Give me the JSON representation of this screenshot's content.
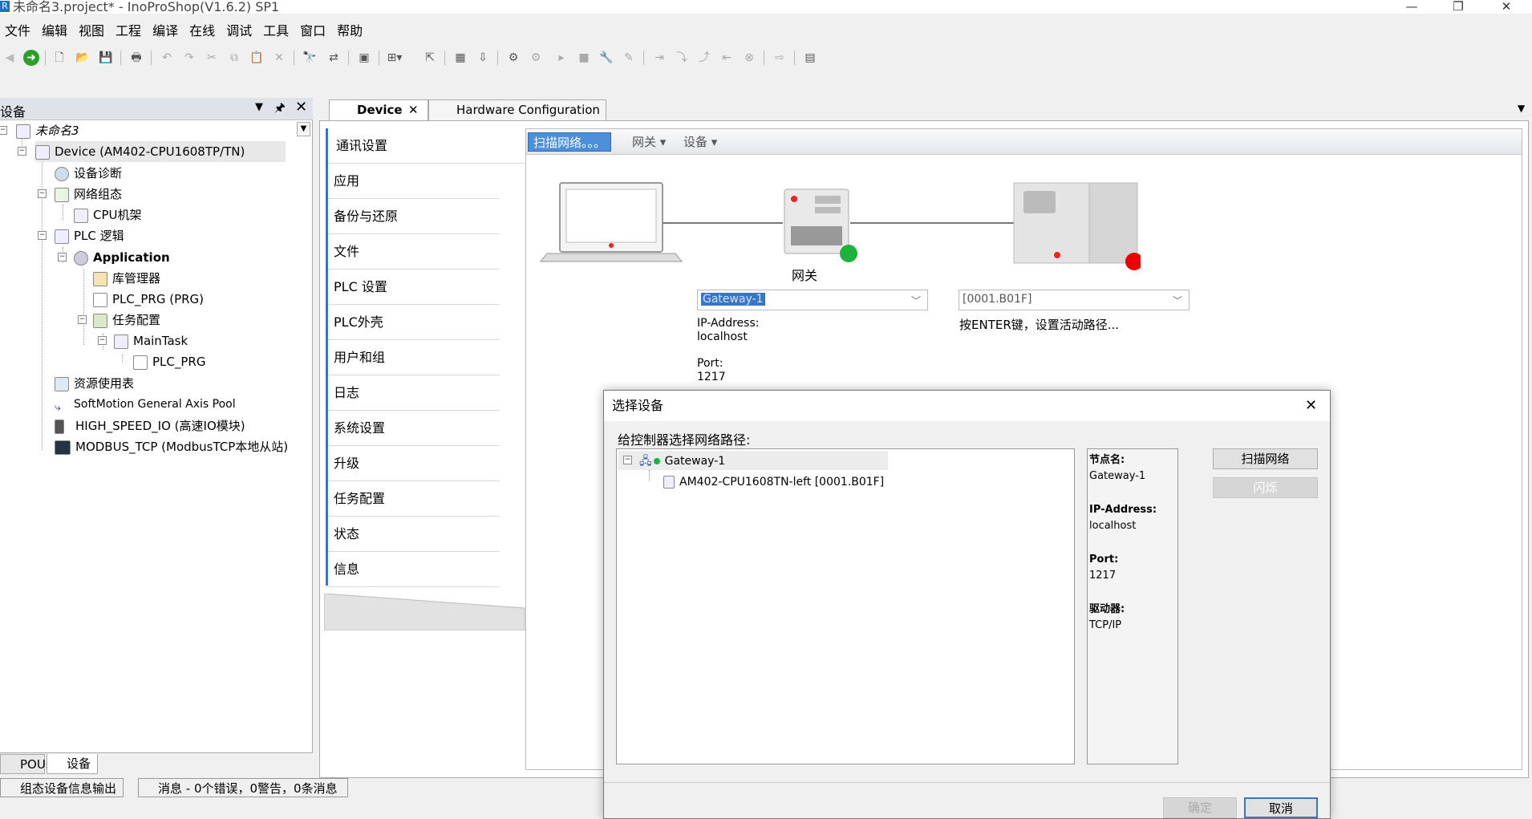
{
  "window": {
    "title": "未命名3.project* - InoProShop(V1.6.2) SP1",
    "app_icon": "R"
  },
  "menubar": [
    "文件",
    "编辑",
    "视图",
    "工程",
    "编译",
    "在线",
    "调试",
    "工具",
    "窗口",
    "帮助"
  ],
  "devices_panel": {
    "title": "设备",
    "tree": [
      {
        "label": "未命名3",
        "icon": "project-icon"
      },
      {
        "label": "Device (AM402-CPU1608TP/TN)",
        "icon": "device-icon"
      },
      {
        "label": "设备诊断",
        "icon": "magnifier-icon"
      },
      {
        "label": "网络组态",
        "icon": "network-config-icon"
      },
      {
        "label": "CPU机架",
        "icon": "cpu-rack-icon"
      },
      {
        "label": "PLC 逻辑",
        "icon": "plc-logic-icon"
      },
      {
        "label": "Application",
        "icon": "gear-icon"
      },
      {
        "label": "库管理器",
        "icon": "library-icon"
      },
      {
        "label": "PLC_PRG (PRG)",
        "icon": "program-icon"
      },
      {
        "label": "任务配置",
        "icon": "task-config-icon"
      },
      {
        "label": "MainTask",
        "icon": "task-icon"
      },
      {
        "label": "PLC_PRG",
        "icon": "program-call-icon"
      },
      {
        "label": "资源使用表",
        "icon": "table-icon"
      },
      {
        "label": "SoftMotion General Axis Pool",
        "icon": "axis-icon"
      },
      {
        "label": "HIGH_SPEED_IO (高速IO模块)",
        "icon": "io-module-icon"
      },
      {
        "label": "MODBUS_TCP (ModbusTCP本地从站)",
        "icon": "modbus-icon"
      }
    ],
    "bottom_tabs": [
      "POUs",
      "设备"
    ]
  },
  "status_tabs": [
    "组态设备信息输出",
    "消息 - 0个错误，0警告，0条消息"
  ],
  "editor": {
    "tabs": [
      "Device",
      "Hardware Configuration"
    ],
    "nav": [
      "通讯设置",
      "应用",
      "备份与还原",
      "文件",
      "PLC 设置",
      "PLC外壳",
      "用户和组",
      "日志",
      "系统设置",
      "升级",
      "任务配置",
      "状态",
      "信息"
    ],
    "toolbar": {
      "scan": "扫描网络。。。",
      "gateway": "网关",
      "device": "设备"
    },
    "gateway_caption": "网关",
    "gateway_select": "Gateway-1",
    "device_select": "[0001.B01F]",
    "hint": "按ENTER键，设置活动路径...",
    "ip_label": "IP-Address:",
    "ip_value": "localhost",
    "port_label": "Port:",
    "port_value": "1217"
  },
  "dialog": {
    "title": "选择设备",
    "prompt": "给控制器选择网络路径:",
    "tree": [
      {
        "label": "Gateway-1"
      },
      {
        "label": "AM402-CPU1608TN-left [0001.B01F]"
      }
    ],
    "details": {
      "node_label": "节点名:",
      "node_value": "Gateway-1",
      "ip_label": "IP-Address:",
      "ip_value": "localhost",
      "port_label": "Port:",
      "port_value": "1217",
      "driver_label": "驱动器:",
      "driver_value": "TCP/IP"
    },
    "scan_button": "扫描网络",
    "blink_button": "闪烁",
    "ok_button": "确定",
    "cancel_button": "取消"
  }
}
